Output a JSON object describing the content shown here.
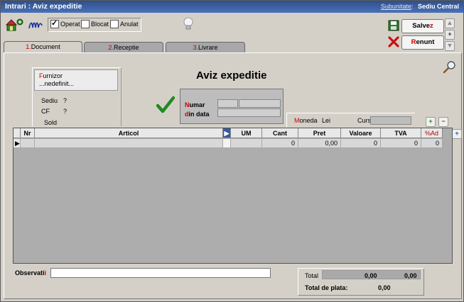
{
  "window": {
    "title": "Intrari : Aviz expeditie",
    "subunit_label": "Subunitate",
    "subunit_value": "Sediu Central"
  },
  "toolbar": {
    "operat_label": "Operat",
    "operat_checked": true,
    "blocat_label": "Blocat",
    "anulat_label": "Anulat"
  },
  "actions": {
    "save_prefix": "Salve",
    "save_hotkey": "z",
    "cancel_hotkey": "R",
    "cancel_rest": "enunt"
  },
  "tabs": [
    {
      "num": "1.",
      "label": "Document"
    },
    {
      "num": "2.",
      "label": "Receptie"
    },
    {
      "num": "3.",
      "label": "Livrare"
    }
  ],
  "supplier": {
    "label_hotkey": "F",
    "label_rest": "urnizor",
    "value": "...nedefinit...",
    "sediu_label": "Sediu",
    "sediu_value": "?",
    "cf_label": "CF",
    "cf_value": "?",
    "sold_label": "Sold"
  },
  "document": {
    "heading": "Aviz expeditie",
    "numar_hotkey": "N",
    "numar_rest": "umar",
    "date_hotkey": "d",
    "date_rest": "in data"
  },
  "currency": {
    "moneda_hotkey": "M",
    "moneda_rest": "oneda",
    "moneda_value": "Lei",
    "curs_label": "Curs"
  },
  "grid": {
    "columns": [
      "Nr",
      "Articol",
      "UM",
      "Cant",
      "Pret",
      "Valoare",
      "TVA",
      "%Ad"
    ],
    "row": {
      "nr": "",
      "articol": "",
      "um": "",
      "cant": "0",
      "pret": "0,00",
      "valoare": "0",
      "tva": "0",
      "ad": "0"
    }
  },
  "footer": {
    "obs_label": "Observati",
    "obs_hotkey": "i",
    "total_label": "Total",
    "total_value": "0,00",
    "total_tva": "0,00",
    "total_plata_label": "Total de plata:",
    "total_plata_value": "0,00"
  }
}
